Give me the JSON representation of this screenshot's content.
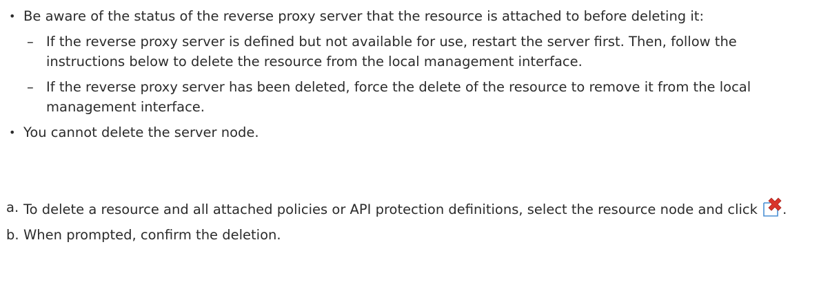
{
  "bullets": [
    {
      "text": "Be aware of the status of the reverse proxy server that the resource is attached to before deleting it:",
      "sub_items": [
        "If the reverse proxy server is defined but not available for use, restart the server first. Then, follow the instructions below to delete the resource from the local management interface.",
        "If the reverse proxy server has been deleted, force the delete of the resource to remove it from the local management interface."
      ]
    },
    {
      "text": "You cannot delete the server node."
    }
  ],
  "steps": [
    {
      "marker": "a.",
      "text_before_icon": "To delete a resource and all attached policies or API protection definitions, select the resource node and click",
      "icon": "delete-resource-icon",
      "text_after_icon": "."
    },
    {
      "marker": "b.",
      "text": "When prompted, confirm the deletion."
    }
  ],
  "colors": {
    "text": "#2b2b2b",
    "icon_x": "#d9342b",
    "icon_page": "#4a8fd4"
  }
}
